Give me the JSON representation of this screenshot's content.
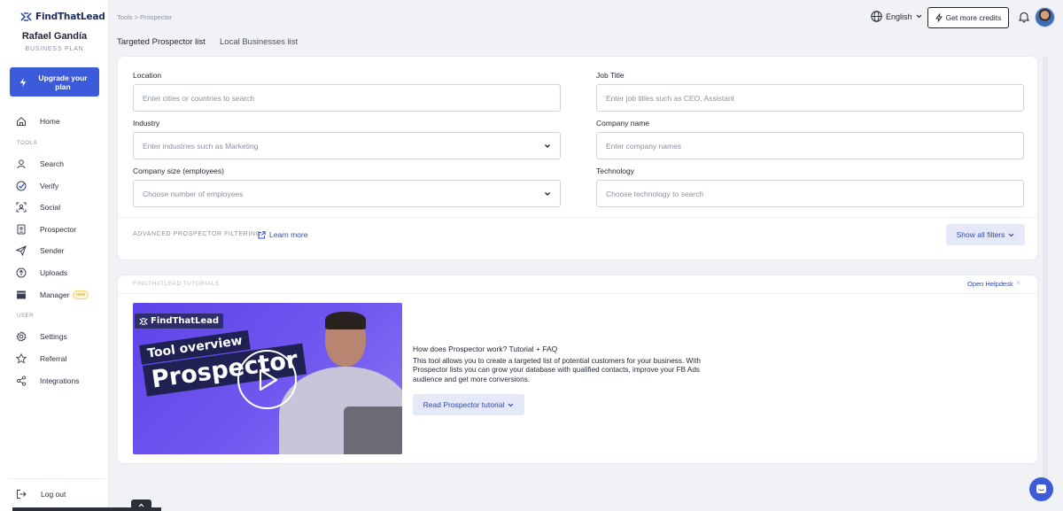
{
  "brand": {
    "name": "FindThatLead"
  },
  "user": {
    "name": "Rafael Gandía",
    "plan": "BUSINESS PLAN"
  },
  "sidebar": {
    "upgrade_label": "Upgrade your plan",
    "home": "Home",
    "tools_section": "TOOLS",
    "tools": [
      "Search",
      "Verify",
      "Social",
      "Prospector",
      "Sender",
      "Uploads",
      "Manager"
    ],
    "new_badge": "new",
    "user_section": "USER",
    "user_items": [
      "Settings",
      "Referral",
      "Integrations"
    ],
    "logout": "Log out"
  },
  "header": {
    "breadcrumb": "Tools > Prospector",
    "language": "English",
    "credits_label": "Get more credits"
  },
  "tabs": [
    "Targeted Prospector list",
    "Local Businesses list"
  ],
  "filters": {
    "location": {
      "label": "Location",
      "placeholder": "Enter cities or countries to search"
    },
    "job_title": {
      "label": "Job Title",
      "placeholder": "Enter job titles such as CEO, Assistant"
    },
    "industry": {
      "label": "Industry",
      "placeholder": "Enter industries such as Marketing"
    },
    "company_name": {
      "label": "Company name",
      "placeholder": "Enter company names"
    },
    "company_size": {
      "label": "Company size (employees)",
      "placeholder": "Choose number of employees"
    },
    "technology": {
      "label": "Technology",
      "placeholder": "Choose technology to search"
    },
    "advanced_label": "ADVANCED PROSPECTOR FILTERING",
    "learn_more": "Learn more",
    "show_all": "Show all filters"
  },
  "tutorial": {
    "section_label": "FINDTHATLEAD TUTORIALS",
    "open_helpdesk": "Open Helpdesk",
    "close": "×",
    "video_brand": "FindThatLead",
    "video_line1": "Tool overview",
    "video_line2": "Prospector",
    "title": "How does Prospector work? Tutorial + FAQ",
    "description": "This tool allows you to create a targeted list of potential customers for your business. With Prospector lists you can grow your database with qualified contacts, improve your FB Ads audience and get more conversions.",
    "button": "Read Prospector tutorial"
  },
  "colors": {
    "accent": "#3b5bdb",
    "link": "#2f4bb5",
    "video_bg": "#6a50ee"
  }
}
